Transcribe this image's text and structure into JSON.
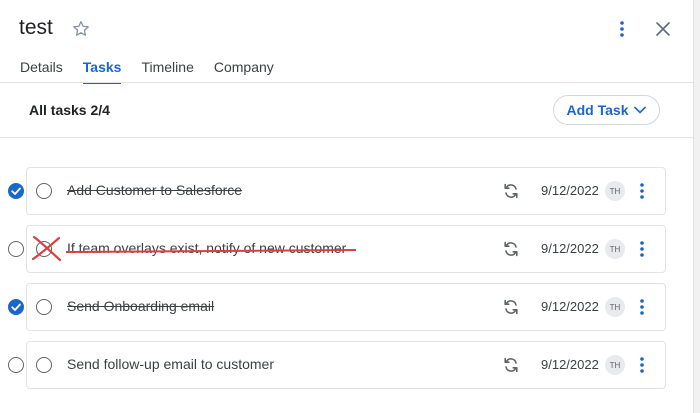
{
  "header": {
    "title": "test",
    "icons": {
      "star": "star-outline-icon",
      "more": "more-vertical-icon",
      "close": "close-icon"
    }
  },
  "tabs": [
    {
      "label": "Details",
      "active": false
    },
    {
      "label": "Tasks",
      "active": true
    },
    {
      "label": "Timeline",
      "active": false
    },
    {
      "label": "Company",
      "active": false
    }
  ],
  "toolbar": {
    "summary": "All tasks 2/4",
    "add_task_label": "Add Task"
  },
  "tasks": [
    {
      "name": "Add Customer to Salesforce",
      "selected": true,
      "completed": true,
      "date": "9/12/2022",
      "assignee": "TH"
    },
    {
      "name": "If team overlays exist, notify of new customer",
      "selected": false,
      "completed": false,
      "date": "9/12/2022",
      "assignee": "TH",
      "annotation": "red-strike"
    },
    {
      "name": "Send Onboarding email",
      "selected": true,
      "completed": true,
      "date": "9/12/2022",
      "assignee": "TH"
    },
    {
      "name": "Send follow-up email to customer",
      "selected": false,
      "completed": false,
      "date": "9/12/2022",
      "assignee": "TH"
    }
  ],
  "colors": {
    "accent": "#1a66c9",
    "annotation": "#d94040"
  }
}
